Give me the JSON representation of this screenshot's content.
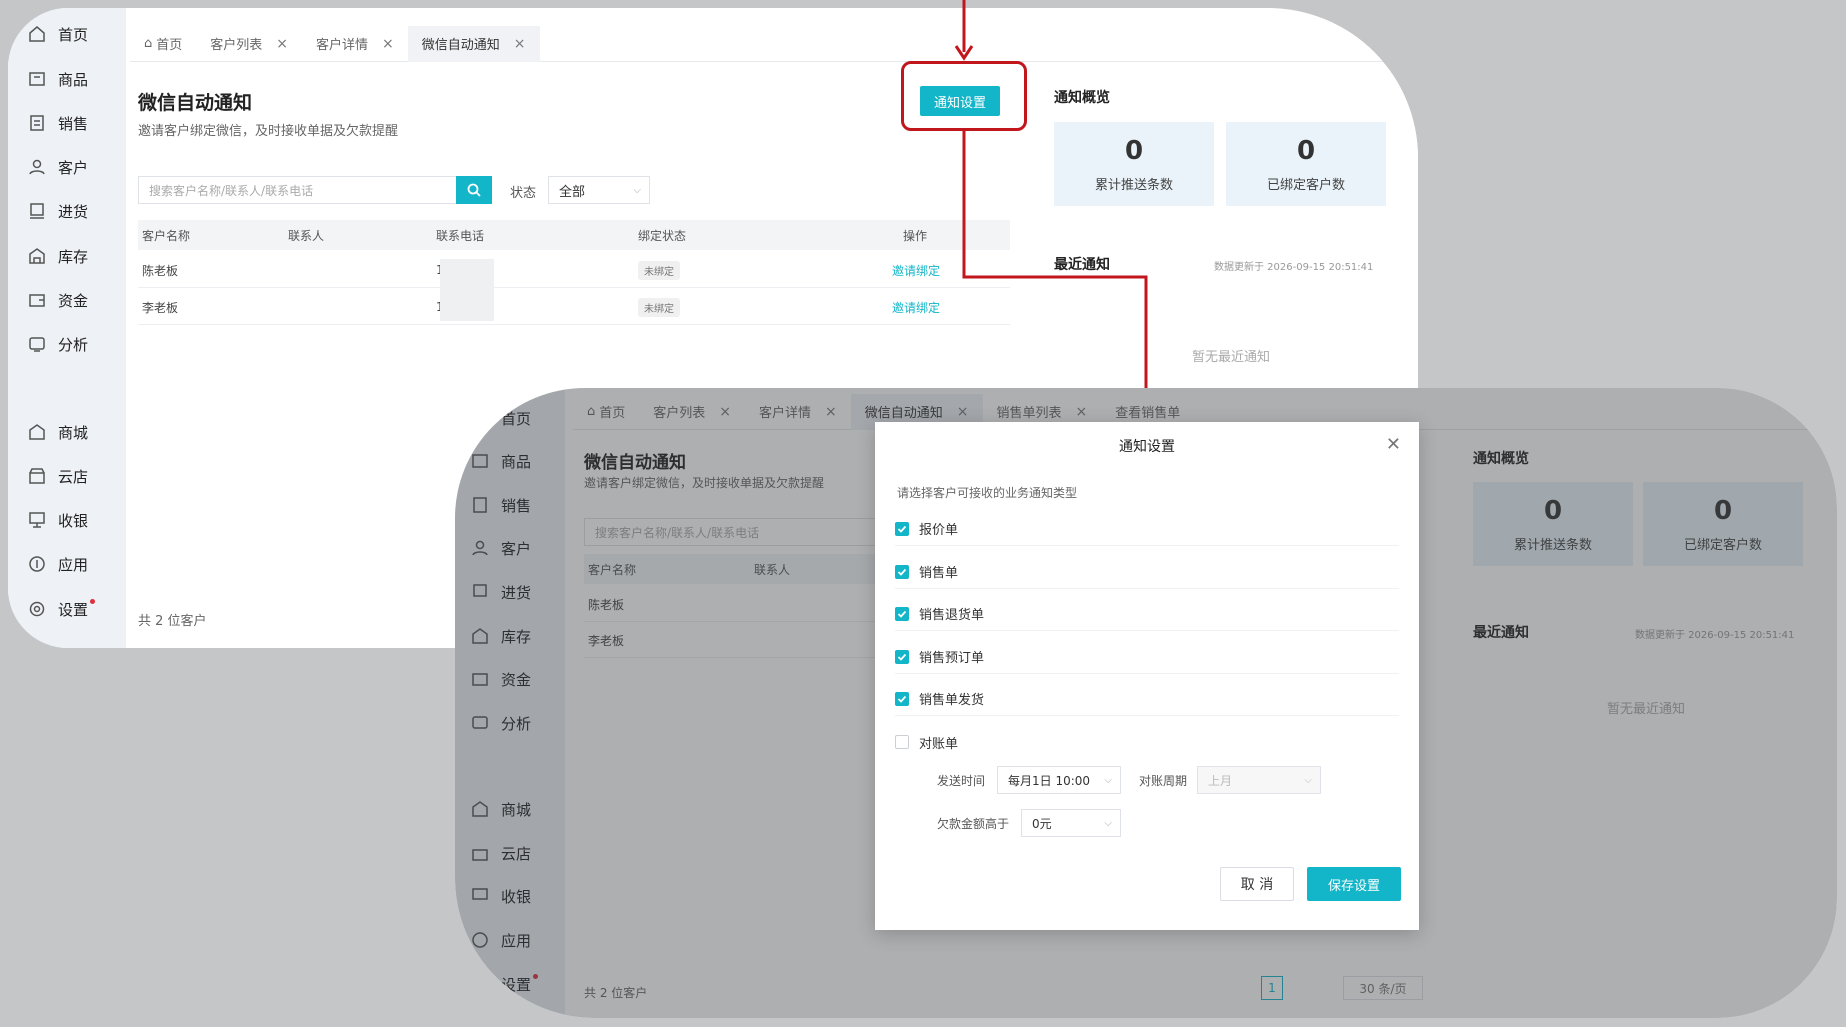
{
  "sidebar": {
    "items": [
      {
        "label": "首页",
        "icon": "home-icon"
      },
      {
        "label": "商品",
        "icon": "box-icon"
      },
      {
        "label": "销售",
        "icon": "sales-doc-icon"
      },
      {
        "label": "客户",
        "icon": "user-icon"
      },
      {
        "label": "进货",
        "icon": "purchase-icon"
      },
      {
        "label": "库存",
        "icon": "warehouse-icon"
      },
      {
        "label": "资金",
        "icon": "wallet-icon"
      },
      {
        "label": "分析",
        "icon": "chart-icon"
      },
      {
        "label": "商城",
        "icon": "mall-icon"
      },
      {
        "label": "云店",
        "icon": "store-icon"
      },
      {
        "label": "收银",
        "icon": "cashier-icon"
      },
      {
        "label": "应用",
        "icon": "apps-icon"
      },
      {
        "label": "设置",
        "icon": "settings-icon"
      }
    ]
  },
  "panel1": {
    "tabs": [
      "首页",
      "客户列表",
      "客户详情",
      "微信自动通知"
    ],
    "title": "微信自动通知",
    "subtitle": "邀请客户绑定微信，及时接收单据及欠款提醒",
    "notify_settings_btn": "通知设置",
    "search_placeholder": "搜索客户名称/联系人/联系电话",
    "status_label": "状态",
    "status_value": "全部",
    "columns": [
      "客户名称",
      "联系人",
      "联系电话",
      "绑定状态",
      "操作"
    ],
    "rows": [
      {
        "name": "陈老板",
        "contact": "",
        "phone": "13",
        "status": "未绑定",
        "action": "邀请绑定"
      },
      {
        "name": "李老板",
        "contact": "",
        "phone": "13",
        "status": "未绑定",
        "action": "邀请绑定"
      }
    ],
    "total": "共 2 位客户",
    "overview_title": "通知概览",
    "stats": [
      {
        "num": "0",
        "cap": "累计推送条数"
      },
      {
        "num": "0",
        "cap": "已绑定客户数"
      }
    ],
    "recent_title": "最近通知",
    "updated": "数据更新于 2026-09-15 20:51:41",
    "empty": "暂无最近通知"
  },
  "panel2": {
    "tabs": [
      "首页",
      "客户列表",
      "客户详情",
      "微信自动通知",
      "销售单列表",
      "查看销售单"
    ],
    "title": "微信自动通知",
    "subtitle": "邀请客户绑定微信，及时接收单据及欠款提醒",
    "search_placeholder": "搜索客户名称/联系人/联系电话",
    "columns": [
      "客户名称",
      "联系人"
    ],
    "rows": [
      "陈老板",
      "李老板"
    ],
    "total": "共 2 位客户",
    "overview_title": "通知概览",
    "stats": [
      {
        "num": "0",
        "cap": "累计推送条数"
      },
      {
        "num": "0",
        "cap": "已绑定客户数"
      }
    ],
    "recent_title": "最近通知",
    "updated": "数据更新于 2026-09-15 20:51:41",
    "empty": "暂无最近通知",
    "page": "1",
    "page_size": "30 条/页",
    "dialog": {
      "title": "通知设置",
      "hint": "请选择客户可接收的业务通知类型",
      "options": [
        {
          "label": "报价单",
          "checked": true
        },
        {
          "label": "销售单",
          "checked": true
        },
        {
          "label": "销售退货单",
          "checked": true
        },
        {
          "label": "销售预订单",
          "checked": true
        },
        {
          "label": "销售单发货",
          "checked": true
        },
        {
          "label": "对账单",
          "checked": false
        }
      ],
      "send_time_label": "发送时间",
      "send_time_value": "每月1日 10:00",
      "period_label": "对账周期",
      "period_value": "上月",
      "arrears_label": "欠款金额高于",
      "arrears_value": "0元",
      "cancel": "取 消",
      "save": "保存设置"
    }
  },
  "colors": {
    "accent": "#13b5c8",
    "highlight": "#c0161c"
  }
}
